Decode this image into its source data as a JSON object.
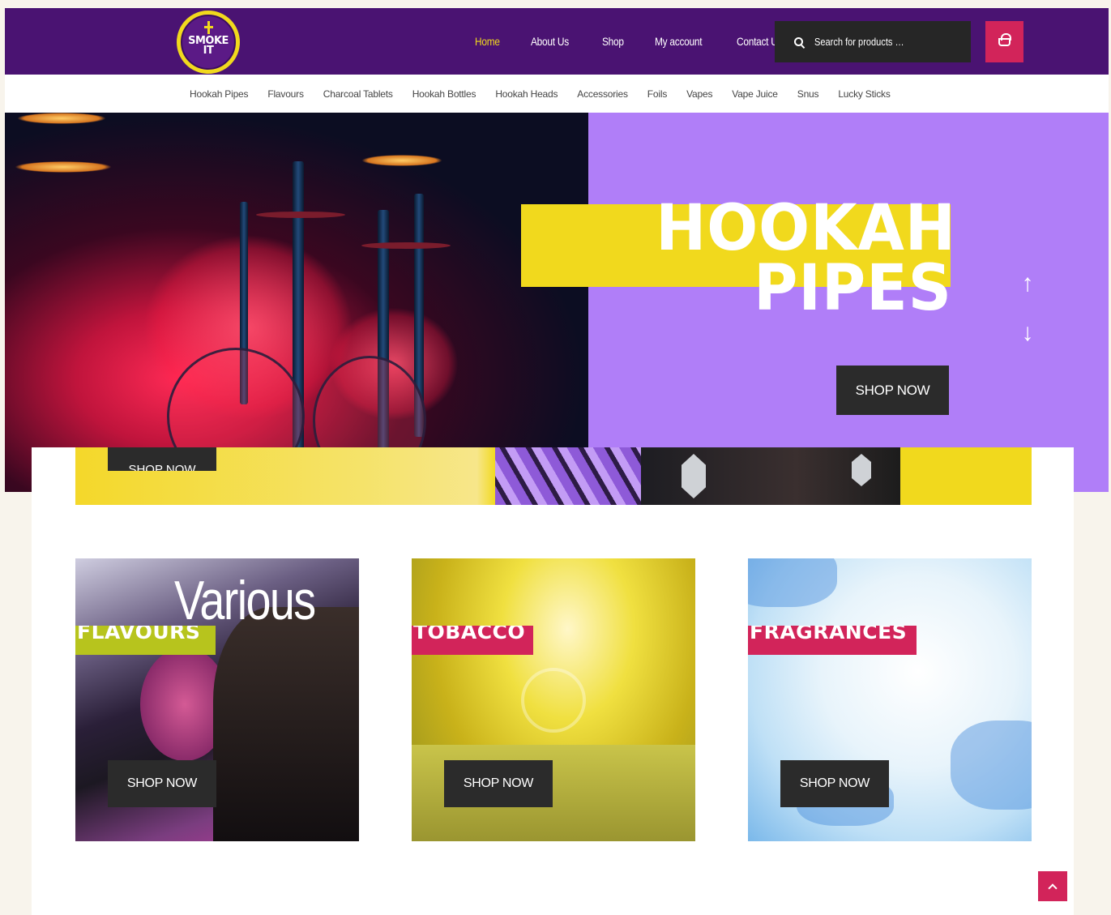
{
  "logo": {
    "text_line1": "SMOKE",
    "text_line2": "IT"
  },
  "nav": {
    "items": [
      {
        "label": "Home",
        "active": true
      },
      {
        "label": "About Us",
        "active": false
      },
      {
        "label": "Shop",
        "active": false
      },
      {
        "label": "My account",
        "active": false
      },
      {
        "label": "Contact Us",
        "active": false
      }
    ],
    "search_placeholder": "Search for products …",
    "search_icon": "search-icon",
    "cart_icon": "basket-icon"
  },
  "categories": [
    "Hookah Pipes",
    "Flavours",
    "Charcoal Tablets",
    "Hookah Bottles",
    "Hookah Heads",
    "Accessories",
    "Foils",
    "Vapes",
    "Vape Juice",
    "Snus",
    "Lucky Sticks"
  ],
  "hero": {
    "title_line1": "HOOKAH",
    "title_line2": "PIPES",
    "button": "SHOP NOW",
    "arrow_up": "↑",
    "arrow_down": "↓"
  },
  "banner2": {
    "button": "SHOP NOW"
  },
  "tiles": [
    {
      "script": "Various",
      "label": "FLAVOURS",
      "button": "SHOP NOW"
    },
    {
      "label": "TOBACCO",
      "button": "SHOP NOW"
    },
    {
      "label": "FRAGRANCES",
      "button": "SHOP NOW"
    }
  ],
  "colors": {
    "header": "#4a1372",
    "accent_yellow": "#f1d91d",
    "accent_pink": "#d2245a",
    "hero_purple": "#b07ef8",
    "button_dark": "#2b2b2b"
  }
}
